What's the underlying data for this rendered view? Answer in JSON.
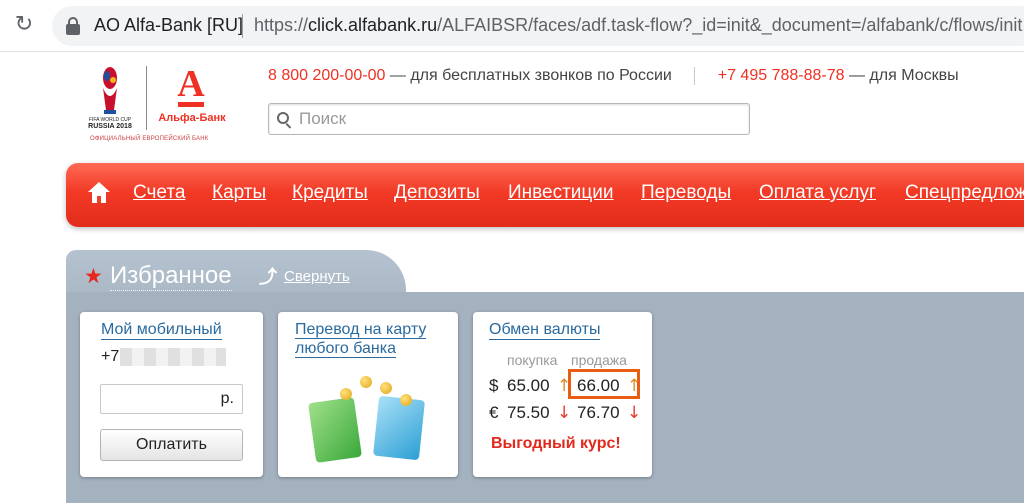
{
  "browser": {
    "site_name": "AO Alfa-Bank [RU]",
    "url_prefix": "https://",
    "url_domain": "click.alfabank.ru",
    "url_path": "/ALFAIBSR/faces/adf.task-flow?_id=init&_document=/alfabank/c/flows/init.xml"
  },
  "header": {
    "logo_fifa_line1": "FIFA WORLD CUP",
    "logo_fifa_line2": "RUSSIA 2018",
    "logo_alfa_letter": "А",
    "logo_alfa_name": "Альфа-Банк",
    "logo_subtitle": "ОФИЦИАЛЬНЫЙ ЕВРОПЕЙСКИЙ БАНК",
    "phone_free": "8 800 200-00-00",
    "phone_free_desc": "— для бесплатных звонков по России",
    "phone_moscow": "+7 495 788-88-78",
    "phone_moscow_desc": "— для Москвы"
  },
  "search": {
    "placeholder": "Поиск"
  },
  "nav": {
    "items": [
      "Счета",
      "Карты",
      "Кредиты",
      "Депозиты",
      "Инвестиции",
      "Переводы",
      "Оплата услуг",
      "Спецпредложения"
    ]
  },
  "favorites": {
    "title": "Избранное",
    "collapse": "Свернуть",
    "mobile": {
      "title": "Мой мобильный",
      "phone_prefix": "+7",
      "amount_value": "",
      "currency": "р.",
      "pay_button": "Оплатить"
    },
    "transfer": {
      "title_line1": "Перевод на карту",
      "title_line2": "любого банка"
    },
    "exchange": {
      "title": "Обмен валюты",
      "buy_header": "покупка",
      "sell_header": "продажа",
      "rows": [
        {
          "symbol": "$",
          "buy": "65.00",
          "buy_trend": "↑",
          "sell": "66.00",
          "sell_trend": "↑"
        },
        {
          "symbol": "€",
          "buy": "75.50",
          "buy_trend": "↓",
          "sell": "76.70",
          "sell_trend": "↓"
        }
      ],
      "promo": "Выгодный курс!"
    }
  },
  "colors": {
    "brand_red": "#ef3124",
    "link_blue": "#2a6a9e",
    "panel_gray": "#a4b1bf",
    "highlight_orange": "#e85d12"
  }
}
